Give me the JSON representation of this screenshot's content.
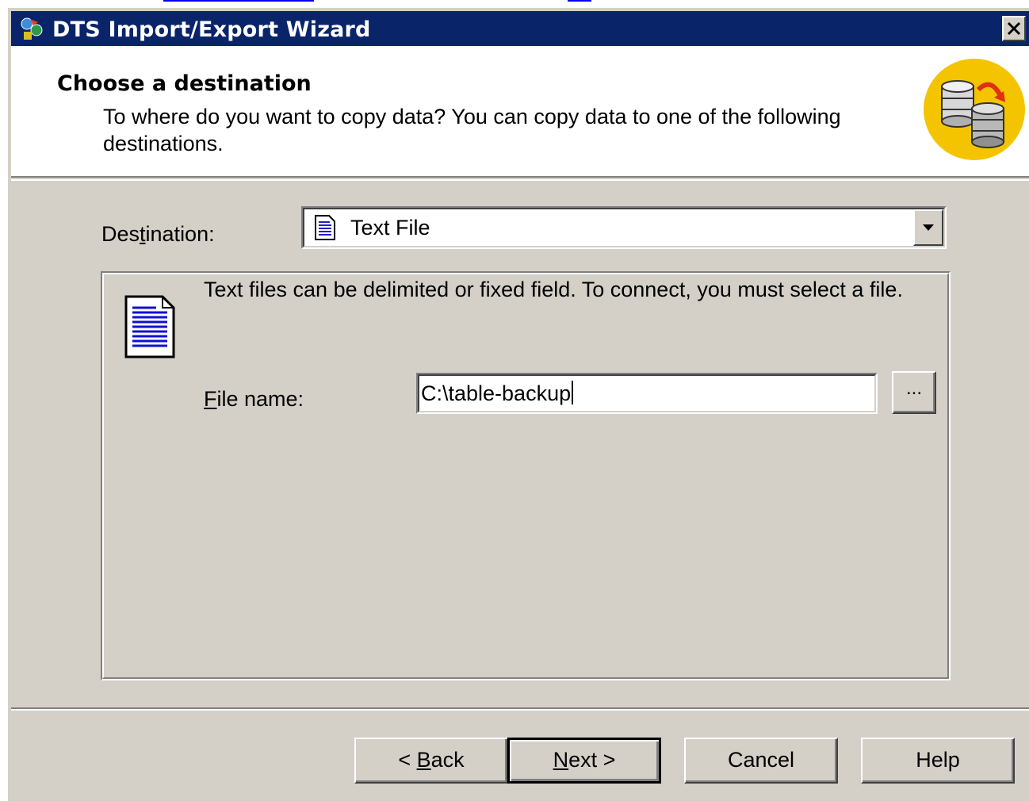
{
  "window": {
    "title": "DTS Import/Export Wizard"
  },
  "header": {
    "title": "Choose a destination",
    "subtitle": "To where do you want to copy data?  You can copy data to one of the following destinations."
  },
  "destination": {
    "label_prefix": "Des",
    "label_accel": "t",
    "label_suffix": "ination:",
    "selected": "Text File"
  },
  "group": {
    "description": "Text files can be delimited or fixed field. To connect, you must select a file.",
    "file_label_accel": "F",
    "file_label_suffix": "ile name:",
    "file_value": "C:\\table-backup",
    "browse_label": "..."
  },
  "buttons": {
    "back_prefix": "< ",
    "back_accel": "B",
    "back_suffix": "ack",
    "next_accel": "N",
    "next_suffix": "ext >",
    "cancel": "Cancel",
    "help": "Help"
  }
}
